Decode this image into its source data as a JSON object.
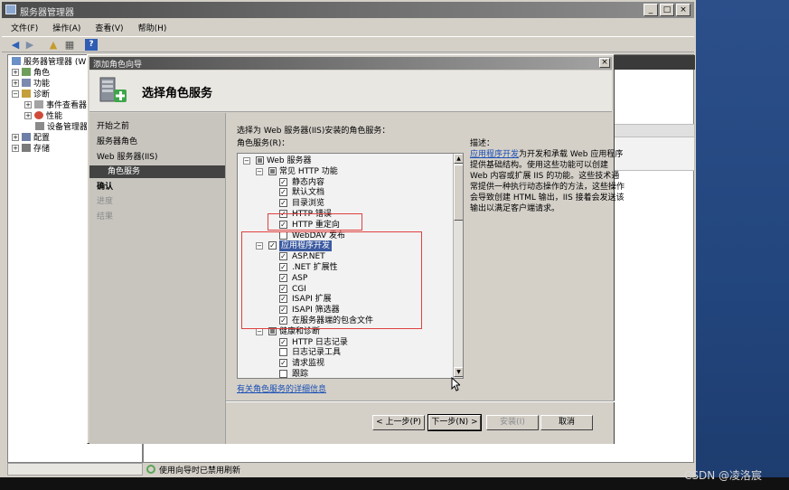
{
  "main_window": {
    "title": "服务器管理器",
    "buttons": {
      "minimize": "_",
      "restore": "□",
      "close": "×"
    },
    "menu": [
      "文件(F)",
      "操作(A)",
      "查看(V)",
      "帮助(H)"
    ],
    "toolbar_icons": [
      "back-arrow-icon",
      "forward-arrow-icon",
      "up-folder-icon",
      "show-hide-tree-icon",
      "help-icon"
    ],
    "tree": [
      {
        "label": "服务器管理器 (W",
        "expander": "",
        "level": 0
      },
      {
        "label": "角色",
        "expander": "+",
        "level": 1
      },
      {
        "label": "功能",
        "expander": "+",
        "level": 1
      },
      {
        "label": "诊断",
        "expander": "−",
        "level": 1
      },
      {
        "label": "事件查看器",
        "expander": "+",
        "level": 2
      },
      {
        "label": "性能",
        "expander": "+",
        "level": 2
      },
      {
        "label": "设备管理器",
        "expander": "",
        "level": 2
      },
      {
        "label": "配置",
        "expander": "+",
        "level": 1
      },
      {
        "label": "存储",
        "expander": "+",
        "level": 1
      }
    ],
    "status_text": "使用向导时已禁用刷新"
  },
  "wizard": {
    "title": "添加角色向导",
    "close": "×",
    "heading": "选择角色服务",
    "nav": [
      {
        "label": "开始之前",
        "state": "normal"
      },
      {
        "label": "服务器角色",
        "state": "normal"
      },
      {
        "label": "Web 服务器(IIS)",
        "state": "normal"
      },
      {
        "label": "角色服务",
        "state": "active"
      },
      {
        "label": "确认",
        "state": "bold"
      },
      {
        "label": "进度",
        "state": "dim"
      },
      {
        "label": "结果",
        "state": "dim"
      }
    ],
    "prompt": "选择为 Web 服务器(IIS)安装的角色服务：",
    "role_services_label": "角色服务(R)：",
    "services": [
      {
        "label": "Web 服务器",
        "level": 0,
        "expander": "−",
        "check": "partial"
      },
      {
        "label": "常见 HTTP 功能",
        "level": 1,
        "expander": "−",
        "check": "partial"
      },
      {
        "label": "静态内容",
        "level": 2,
        "check": "checked"
      },
      {
        "label": "默认文档",
        "level": 2,
        "check": "checked"
      },
      {
        "label": "目录浏览",
        "level": 2,
        "check": "checked"
      },
      {
        "label": "HTTP 错误",
        "level": 2,
        "check": "checked"
      },
      {
        "label": "HTTP 重定向",
        "level": 2,
        "check": "checked"
      },
      {
        "label": "WebDAV 发布",
        "level": 2,
        "check": "unchecked"
      },
      {
        "label": "应用程序开发",
        "level": 1,
        "expander": "−",
        "check": "checked",
        "highlight": true
      },
      {
        "label": "ASP.NET",
        "level": 2,
        "check": "checked"
      },
      {
        "label": ".NET 扩展性",
        "level": 2,
        "check": "checked"
      },
      {
        "label": "ASP",
        "level": 2,
        "check": "checked"
      },
      {
        "label": "CGI",
        "level": 2,
        "check": "checked"
      },
      {
        "label": "ISAPI 扩展",
        "level": 2,
        "check": "checked"
      },
      {
        "label": "ISAPI 筛选器",
        "level": 2,
        "check": "checked"
      },
      {
        "label": "在服务器端的包含文件",
        "level": 2,
        "check": "checked"
      },
      {
        "label": "健康和诊断",
        "level": 1,
        "expander": "−",
        "check": "partial"
      },
      {
        "label": "HTTP 日志记录",
        "level": 2,
        "check": "checked"
      },
      {
        "label": "日志记录工具",
        "level": 2,
        "check": "unchecked"
      },
      {
        "label": "请求监视",
        "level": 2,
        "check": "checked"
      },
      {
        "label": "跟踪",
        "level": 2,
        "check": "unchecked"
      }
    ],
    "description_title": "描述：",
    "description_link": "应用程序开发",
    "description_text": "为开发和承载 Web 应用程序提供基础结构。使用这些功能可以创建 Web 内容或扩展 IIS 的功能。这些技术通常提供一种执行动态操作的方法，这些操作会导致创建 HTML 输出，IIS 接着会发送该输出以满足客户端请求。",
    "more_info_link": "有关角色服务的详细信息",
    "buttons": {
      "prev": "< 上一步(P)",
      "next": "下一步(N) >",
      "install": "安装(I)",
      "cancel": "取消"
    }
  },
  "watermark": "CSDN @凌洛宸"
}
